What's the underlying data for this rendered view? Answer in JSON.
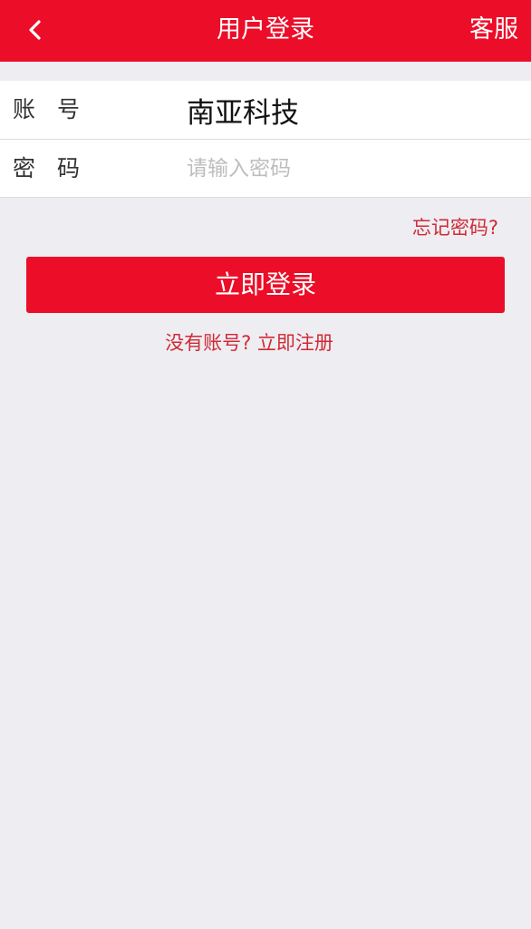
{
  "header": {
    "back_icon": "chevron-left-icon",
    "title": "用户登录",
    "service_label": "客服",
    "background_color": "#ec0d28"
  },
  "form": {
    "account": {
      "label": "账号",
      "value": "南亚科技"
    },
    "password": {
      "label": "密码",
      "placeholder": "请输入密码",
      "value": ""
    }
  },
  "forgot_password_label": "忘记密码?",
  "login_button_label": "立即登录",
  "register_link_label": "没有账号? 立即注册",
  "colors": {
    "accent": "#ec0d28",
    "link": "#cf2a35",
    "background": "#eeedf2"
  }
}
